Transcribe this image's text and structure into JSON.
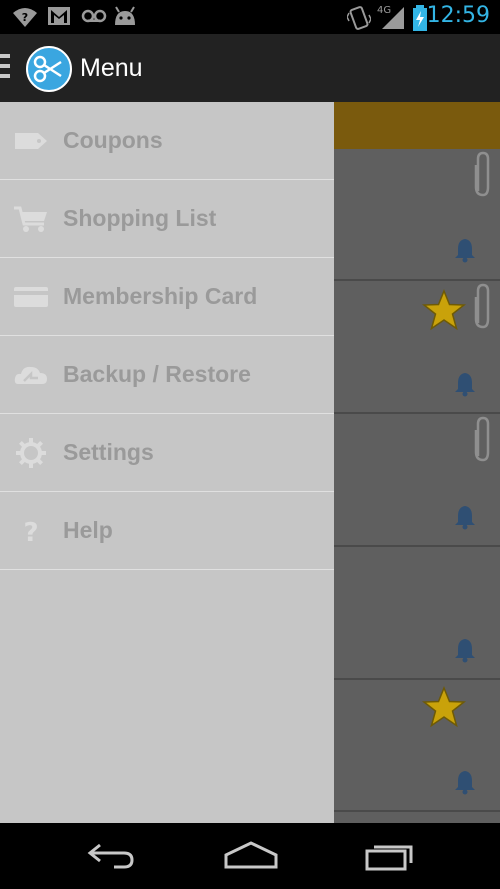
{
  "status_bar": {
    "time": "12:59",
    "network": "4G",
    "icons": [
      "wifi-question-icon",
      "gmail-icon",
      "voicemail-icon",
      "android-icon",
      "vibrate-icon",
      "signal-icon",
      "battery-charging-icon"
    ]
  },
  "action_bar": {
    "title": "Menu",
    "logo_icon": "scissors-icon"
  },
  "drawer": {
    "items": [
      {
        "label": "Coupons",
        "icon": "tag-icon"
      },
      {
        "label": "Shopping List",
        "icon": "cart-icon"
      },
      {
        "label": "Membership Card",
        "icon": "card-icon"
      },
      {
        "label": "Backup / Restore",
        "icon": "cloud-sync-icon"
      },
      {
        "label": "Settings",
        "icon": "gear-icon"
      },
      {
        "label": "Help",
        "icon": "question-icon"
      }
    ]
  },
  "background_list": {
    "cards": [
      {
        "starred": false,
        "attachment": true,
        "reminder": true
      },
      {
        "starred": true,
        "attachment": true,
        "reminder": true
      },
      {
        "starred": false,
        "attachment": true,
        "reminder": true
      },
      {
        "starred": false,
        "attachment": false,
        "reminder": true
      },
      {
        "starred": true,
        "attachment": false,
        "reminder": true
      }
    ]
  },
  "colors": {
    "accent_blue": "#33b5e5",
    "drawer_bg": "#c6c6c6",
    "drawer_text": "#9a9a9a",
    "star": "#c9a20a",
    "strip": "#7a5a0d"
  },
  "nav_bar": {
    "buttons": [
      "back-icon",
      "home-icon",
      "recent-apps-icon"
    ]
  }
}
